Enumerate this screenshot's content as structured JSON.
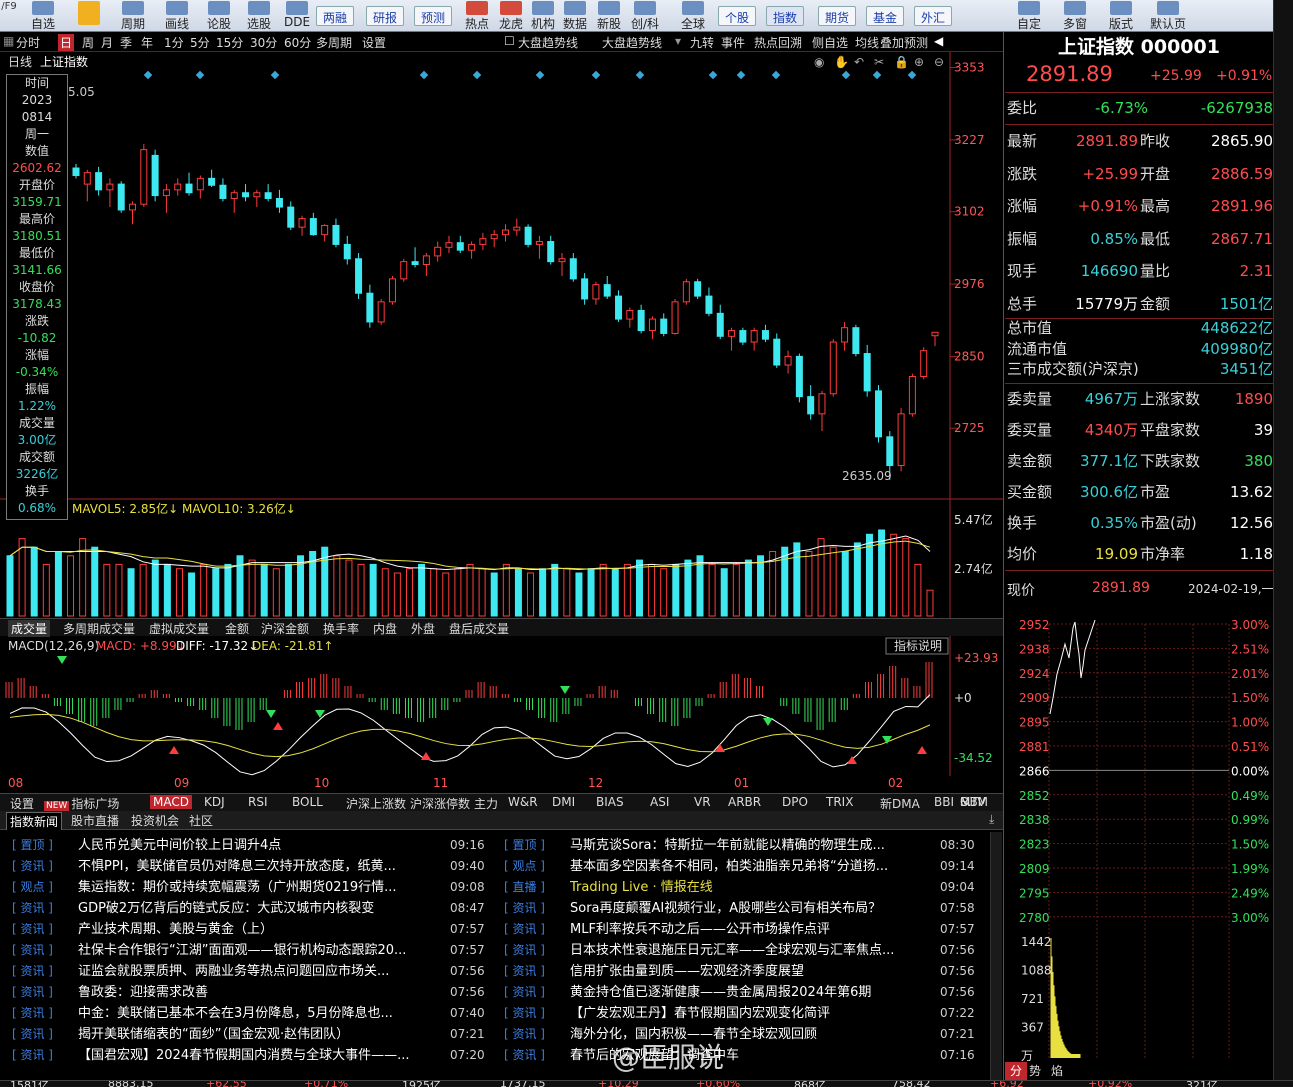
{
  "toolbar": {
    "left_items": [
      "自选",
      "周期",
      "画线",
      "论股",
      "选股",
      "DDE"
    ],
    "buttons": [
      "两融",
      "研报",
      "预测",
      "个股",
      "指数",
      "期货",
      "基金",
      "外汇"
    ],
    "icon_items": [
      "热点",
      "龙虎",
      "机构",
      "数据",
      "新股",
      "创/科",
      "全球"
    ],
    "right_items": [
      "自定",
      "多窗",
      "版式",
      "默认页"
    ]
  },
  "periods": [
    "分时",
    "日",
    "周",
    "月",
    "季",
    "年",
    "1分",
    "5分",
    "15分",
    "30分",
    "60分",
    "多周期",
    "设置"
  ],
  "active_period": "日",
  "overlay_tabs": [
    "大盘趋势线",
    "大盘趋势线",
    "九转",
    "事件",
    "热点回溯",
    "侧自选",
    "均线",
    "叠加",
    "预测"
  ],
  "chart_header": {
    "line1": "日线",
    "name": "上证指数",
    "open_ref": "5.05"
  },
  "price_axis": [
    "3353",
    "3227",
    "3102",
    "2976",
    "2850",
    "2725"
  ],
  "low_label": "2635.09",
  "infobox": {
    "rows": [
      {
        "k": "时间",
        "v": "2023"
      },
      {
        "k": "",
        "v": "0814"
      },
      {
        "k": "周一",
        "v": ""
      },
      {
        "k": "数值",
        "v": "2602.62"
      },
      {
        "k": "开盘价",
        "v": "3159.71"
      },
      {
        "k": "最高价",
        "v": "3180.51"
      },
      {
        "k": "最低价",
        "v": "3141.66"
      },
      {
        "k": "收盘价",
        "v": "3178.43"
      },
      {
        "k": "涨跌",
        "v": "-10.82"
      },
      {
        "k": "涨幅",
        "v": "-0.34%"
      },
      {
        "k": "振幅",
        "v": "1.22%"
      },
      {
        "k": "成交量",
        "v": "3.00亿"
      },
      {
        "k": "成交额",
        "v": "3226亿"
      },
      {
        "k": "换手",
        "v": "0.68%"
      }
    ]
  },
  "volume": {
    "legend": "MAVOL5: 2.85亿↓ MAVOL10: 3.26亿↓",
    "axis": [
      "5.47亿",
      "2.74亿"
    ]
  },
  "vol_tabs": [
    "成交量",
    "多周期成交量",
    "虚拟成交量",
    "金额",
    "沪深金额",
    "换手率",
    "内盘",
    "外盘",
    "盘后成交量"
  ],
  "macd": {
    "legend_name": "MACD(12,26,9)",
    "macd": "MACD: +8.99↓",
    "diff": "DIFF: -17.32↓",
    "dea": "DEA: -21.81↑",
    "axis": [
      "+23.93",
      "+0",
      "-34.52"
    ],
    "help": "指标说明"
  },
  "date_labels": [
    "08",
    "09",
    "10",
    "11",
    "12",
    "01",
    "02"
  ],
  "indicator_tabs": [
    "设置",
    "NEW 指标广场",
    "MACD",
    "KDJ",
    "RSI",
    "BOLL",
    "沪深上涨数",
    "沪深涨停数",
    "主力",
    "W&R",
    "DMI",
    "BIAS",
    "ASI",
    "VR",
    "ARBR",
    "DPO",
    "TRIX",
    "新DMA",
    "BBI",
    "MTM",
    "OBV",
    "S.."
  ],
  "news_tabs": [
    "指数新闻",
    "股市直播",
    "投资机会",
    "社区"
  ],
  "news_left": [
    {
      "tag": "置顶",
      "title": "人民币兑美元中间价较上日调升4点",
      "time": "09:16"
    },
    {
      "tag": "资讯",
      "title": "不惧PPI，美联储官员仍对降息三次持开放态度，纸黄...",
      "time": "09:40"
    },
    {
      "tag": "观点",
      "title": "集运指数：期价或持续宽幅震荡（广州期货0219行情...",
      "time": "09:08"
    },
    {
      "tag": "资讯",
      "title": "GDP破2万亿背后的链式反应：大武汉城市内核裂变",
      "time": "08:47"
    },
    {
      "tag": "资讯",
      "title": "产业技术周期、美股与黄金（上）",
      "time": "07:57"
    },
    {
      "tag": "资讯",
      "title": "社保卡合作银行“江湖”面面观——银行机构动态跟踪20...",
      "time": "07:57"
    },
    {
      "tag": "资讯",
      "title": "证监会就股票质押、两融业务等热点问题回应市场关...",
      "time": "07:56"
    },
    {
      "tag": "资讯",
      "title": "鲁政委：迎接需求改善",
      "time": "07:56"
    },
    {
      "tag": "资讯",
      "title": "中金：美联储已基本不会在3月份降息，5月份降息也...",
      "time": "07:40"
    },
    {
      "tag": "资讯",
      "title": "揭开美联储缩表的“面纱”（国金宏观·赵伟团队）",
      "time": "07:21"
    },
    {
      "tag": "资讯",
      "title": "【国君宏观】2024春节假期国内消费与全球大事件——...",
      "time": "07:20"
    }
  ],
  "news_right": [
    {
      "tag": "置顶",
      "title": "马斯克谈Sora：特斯拉一年前就能以精确的物理生成...",
      "time": "08:30"
    },
    {
      "tag": "观点",
      "title": "基本面多空因素各不相同，柏类油脂亲兄弟将“分道扬...",
      "time": "09:14"
    },
    {
      "tag": "直播",
      "title": " Trading Live · 情报在线",
      "time": "09:04"
    },
    {
      "tag": "资讯",
      "title": "Sora再度颠覆AI视频行业，A股哪些公司有相关布局？",
      "time": "07:58"
    },
    {
      "tag": "资讯",
      "title": "MLF利率按兵不动之后——公开市场操作点评",
      "time": "07:57"
    },
    {
      "tag": "资讯",
      "title": "日本技术性衰退施压日元汇率——全球宏观与汇率焦点...",
      "time": "07:56"
    },
    {
      "tag": "资讯",
      "title": "信用扩张由量到质——宏观经济季度展望",
      "time": "07:56"
    },
    {
      "tag": "资讯",
      "title": "黄金持仓值已逐渐健康——贵金属周报2024年第6期",
      "time": "07:56"
    },
    {
      "tag": "资讯",
      "title": "【广发宏观王丹】春节假期国内宏观变化简评",
      "time": "07:22"
    },
    {
      "tag": "资讯",
      "title": "海外分化，国内积极——春节全球宏观回顾",
      "time": "07:21"
    },
    {
      "tag": "资讯",
      "title": "春节后的宏观展望：调查中车",
      "time": "07:16"
    }
  ],
  "watermark": "@臣服说",
  "right_panel": {
    "title": "上证指数 000001",
    "price": "2891.89",
    "change": "+25.99",
    "pct": "+0.91%",
    "weibi": {
      "label": "委比",
      "v1": "-6.73%",
      "v2": "-6267938"
    },
    "grid": [
      {
        "l1": "最新",
        "v1": "2891.89",
        "c1": "red",
        "l2": "昨收",
        "v2": "2865.90",
        "c2": "white"
      },
      {
        "l1": "涨跌",
        "v1": "+25.99",
        "c1": "red",
        "l2": "开盘",
        "v2": "2886.59",
        "c2": "red"
      },
      {
        "l1": "涨幅",
        "v1": "+0.91%",
        "c1": "red",
        "l2": "最高",
        "v2": "2891.96",
        "c2": "red"
      },
      {
        "l1": "振幅",
        "v1": "0.85%",
        "c1": "cyan",
        "l2": "最低",
        "v2": "2867.71",
        "c2": "red"
      },
      {
        "l1": "现手",
        "v1": "146690",
        "c1": "cyan",
        "l2": "量比",
        "v2": "2.31",
        "c2": "red"
      },
      {
        "l1": "总手",
        "v1": "15779万",
        "c1": "white",
        "l2": "金额",
        "v2": "1501亿",
        "c2": "cyan"
      }
    ],
    "caps": [
      {
        "l": "总市值",
        "v": "448622亿"
      },
      {
        "l": "流通市值",
        "v": "409980亿"
      },
      {
        "l": "三市成交额(沪深京)",
        "v": "3451亿"
      }
    ],
    "grid2": [
      {
        "l1": "委卖量",
        "v1": "4967万",
        "c1": "cyan",
        "l2": "上涨家数",
        "v2": "1890",
        "c2": "red"
      },
      {
        "l1": "委买量",
        "v1": "4340万",
        "c1": "red",
        "l2": "平盘家数",
        "v2": "39",
        "c2": "white"
      },
      {
        "l1": "卖金额",
        "v1": "377.1亿",
        "c1": "cyan",
        "l2": "下跌家数",
        "v2": "380",
        "c2": "green"
      },
      {
        "l1": "买金额",
        "v1": "300.6亿",
        "c1": "cyan",
        "l2": "市盈",
        "v2": "13.62",
        "c2": "white"
      },
      {
        "l1": "换手",
        "v1": "0.35%",
        "c1": "cyan",
        "l2": "市盈(动)",
        "v2": "12.56",
        "c2": "white"
      },
      {
        "l1": "均价",
        "v1": "19.09",
        "c1": "yellow",
        "l2": "市净率",
        "v2": "1.18",
        "c2": "white"
      }
    ],
    "cur_label": "现价",
    "cur_val": "2891.89",
    "cur_date": "2024-02-19,一",
    "intraday_left": [
      "2952",
      "2938",
      "2924",
      "2909",
      "2895",
      "2881",
      "2866",
      "2852",
      "2838",
      "2823",
      "2809",
      "2795",
      "2780"
    ],
    "intraday_right": [
      "3.00%",
      "2.51%",
      "2.01%",
      "1.50%",
      "1.00%",
      "0.51%",
      "0.00%",
      "0.49%",
      "0.99%",
      "1.50%",
      "1.99%",
      "2.49%",
      "3.00%"
    ],
    "intraday_vol": [
      "1442",
      "1088",
      "721",
      "367",
      "万"
    ],
    "bottom_tabs": [
      "分",
      "势",
      "焰"
    ]
  },
  "status": {
    "items": [
      "1581亿",
      "8883.15",
      "+62.55",
      "+0.71%",
      "1925亿",
      "1737.15",
      "+10.29",
      "+0.60%",
      "868亿",
      "758.42",
      "+6.92",
      "+0.92%",
      "321亿"
    ]
  },
  "chart_data": {
    "type": "candlestick",
    "title": "上证指数",
    "ylim": [
      2600,
      3380
    ],
    "x_labels": [
      "08",
      "09",
      "10",
      "11",
      "12",
      "01",
      "02"
    ],
    "candles_ohlc": [
      [
        3178,
        3185,
        3160,
        3165
      ],
      [
        3150,
        3175,
        3120,
        3170
      ],
      [
        3170,
        3180,
        3130,
        3140
      ],
      [
        3140,
        3160,
        3110,
        3150
      ],
      [
        3150,
        3155,
        3100,
        3105
      ],
      [
        3105,
        3120,
        3080,
        3115
      ],
      [
        3115,
        3220,
        3110,
        3210
      ],
      [
        3200,
        3210,
        3120,
        3130
      ],
      [
        3130,
        3150,
        3100,
        3140
      ],
      [
        3140,
        3160,
        3130,
        3150
      ],
      [
        3150,
        3170,
        3130,
        3135
      ],
      [
        3140,
        3165,
        3125,
        3160
      ],
      [
        3160,
        3175,
        3145,
        3148
      ],
      [
        3148,
        3160,
        3120,
        3125
      ],
      [
        3125,
        3140,
        3100,
        3135
      ],
      [
        3135,
        3150,
        3120,
        3128
      ],
      [
        3128,
        3140,
        3110,
        3135
      ],
      [
        3135,
        3150,
        3120,
        3125
      ],
      [
        3125,
        3140,
        3100,
        3110
      ],
      [
        3110,
        3120,
        3070,
        3075
      ],
      [
        3075,
        3095,
        3060,
        3090
      ],
      [
        3090,
        3100,
        3060,
        3062
      ],
      [
        3062,
        3080,
        3050,
        3078
      ],
      [
        3078,
        3090,
        3040,
        3045
      ],
      [
        3045,
        3060,
        3010,
        3020
      ],
      [
        3020,
        3030,
        2950,
        2960
      ],
      [
        2960,
        2975,
        2900,
        2910
      ],
      [
        2910,
        2950,
        2905,
        2945
      ],
      [
        2945,
        2990,
        2940,
        2985
      ],
      [
        2985,
        3020,
        2980,
        3015
      ],
      [
        3015,
        3040,
        3005,
        3010
      ],
      [
        3010,
        3030,
        2990,
        3025
      ],
      [
        3025,
        3050,
        3015,
        3040
      ],
      [
        3040,
        3060,
        3030,
        3048
      ],
      [
        3048,
        3060,
        3030,
        3035
      ],
      [
        3035,
        3050,
        3020,
        3045
      ],
      [
        3045,
        3065,
        3035,
        3055
      ],
      [
        3055,
        3070,
        3040,
        3062
      ],
      [
        3062,
        3080,
        3050,
        3070
      ],
      [
        3070,
        3090,
        3060,
        3075
      ],
      [
        3075,
        3080,
        3040,
        3045
      ],
      [
        3045,
        3060,
        3020,
        3050
      ],
      [
        3050,
        3060,
        3010,
        3015
      ],
      [
        3015,
        3030,
        2990,
        3020
      ],
      [
        3020,
        3030,
        2980,
        2985
      ],
      [
        2985,
        2995,
        2940,
        2950
      ],
      [
        2950,
        2980,
        2940,
        2975
      ],
      [
        2975,
        2990,
        2950,
        2955
      ],
      [
        2955,
        2965,
        2910,
        2915
      ],
      [
        2915,
        2935,
        2900,
        2930
      ],
      [
        2930,
        2940,
        2890,
        2895
      ],
      [
        2895,
        2920,
        2880,
        2915
      ],
      [
        2915,
        2925,
        2885,
        2890
      ],
      [
        2890,
        2950,
        2888,
        2945
      ],
      [
        2945,
        2985,
        2940,
        2980
      ],
      [
        2980,
        2985,
        2950,
        2955
      ],
      [
        2955,
        2970,
        2920,
        2925
      ],
      [
        2925,
        2940,
        2880,
        2885
      ],
      [
        2885,
        2900,
        2860,
        2895
      ],
      [
        2895,
        2900,
        2870,
        2875
      ],
      [
        2875,
        2900,
        2860,
        2895
      ],
      [
        2895,
        2905,
        2875,
        2880
      ],
      [
        2880,
        2890,
        2830,
        2835
      ],
      [
        2835,
        2860,
        2820,
        2850
      ],
      [
        2850,
        2855,
        2770,
        2780
      ],
      [
        2780,
        2800,
        2740,
        2750
      ],
      [
        2750,
        2790,
        2720,
        2785
      ],
      [
        2785,
        2880,
        2780,
        2875
      ],
      [
        2875,
        2910,
        2860,
        2900
      ],
      [
        2900,
        2905,
        2850,
        2855
      ],
      [
        2855,
        2870,
        2780,
        2790
      ],
      [
        2790,
        2800,
        2700,
        2710
      ],
      [
        2710,
        2720,
        2635,
        2660
      ],
      [
        2660,
        2760,
        2650,
        2750
      ],
      [
        2750,
        2820,
        2745,
        2815
      ],
      [
        2815,
        2866,
        2810,
        2860
      ],
      [
        2886,
        2892,
        2868,
        2892
      ]
    ],
    "volume_rel": [
      0.7,
      0.9,
      0.8,
      0.6,
      0.75,
      0.7,
      0.9,
      0.8,
      0.6,
      0.6,
      0.55,
      0.6,
      0.65,
      0.6,
      0.55,
      0.5,
      0.6,
      0.55,
      0.6,
      0.7,
      0.65,
      0.6,
      0.55,
      0.6,
      0.7,
      0.75,
      0.8,
      0.7,
      0.65,
      0.6,
      0.6,
      0.55,
      0.5,
      0.55,
      0.6,
      0.55,
      0.5,
      0.55,
      0.6,
      0.55,
      0.5,
      0.6,
      0.55,
      0.5,
      0.55,
      0.6,
      0.55,
      0.5,
      0.55,
      0.6,
      0.55,
      0.6,
      0.65,
      0.6,
      0.55,
      0.6,
      0.65,
      0.7,
      0.6,
      0.55,
      0.6,
      0.65,
      0.7,
      0.75,
      0.8,
      0.85,
      0.75,
      0.9,
      0.8,
      0.75,
      0.85,
      0.95,
      1.0,
      0.95,
      0.9,
      0.6,
      0.3
    ],
    "macd_hist": [
      0.4,
      0.5,
      0.3,
      0.1,
      -0.2,
      -0.4,
      -0.6,
      -0.7,
      -0.5,
      -0.3,
      -0.1,
      0.1,
      0.2,
      0.1,
      -0.1,
      -0.2,
      -0.3,
      -0.5,
      -0.7,
      -0.8,
      -0.6,
      -0.3,
      0.0,
      0.2,
      0.4,
      0.5,
      0.6,
      0.5,
      0.3,
      0.1,
      -0.1,
      -0.3,
      -0.4,
      -0.5,
      -0.6,
      -0.5,
      -0.3,
      -0.1,
      0.2,
      0.4,
      0.3,
      0.1,
      -0.1,
      -0.3,
      -0.5,
      -0.6,
      -0.4,
      -0.2,
      0.1,
      0.3,
      0.2,
      0.0,
      -0.2,
      -0.4,
      -0.6,
      -0.7,
      -0.5,
      -0.2,
      0.1,
      0.4,
      0.6,
      0.5,
      0.3,
      0.0,
      -0.2,
      -0.4,
      -0.6,
      -0.8,
      -0.6,
      -0.3,
      0.1,
      0.4,
      0.6,
      0.8,
      0.5,
      0.3,
      0.9
    ]
  }
}
